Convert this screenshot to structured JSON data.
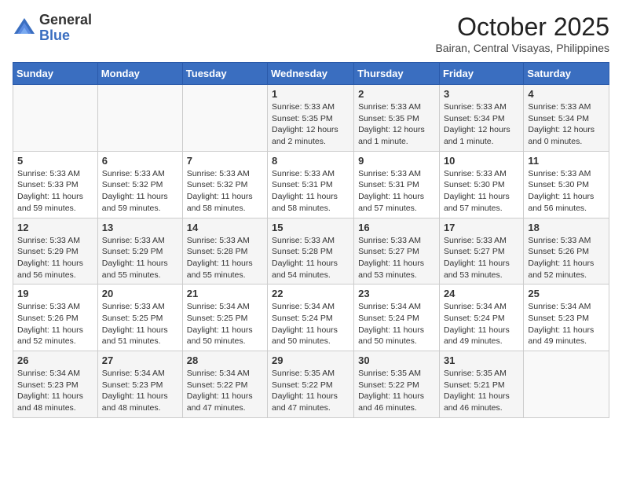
{
  "header": {
    "logo_general": "General",
    "logo_blue": "Blue",
    "month_title": "October 2025",
    "location": "Bairan, Central Visayas, Philippines"
  },
  "weekdays": [
    "Sunday",
    "Monday",
    "Tuesday",
    "Wednesday",
    "Thursday",
    "Friday",
    "Saturday"
  ],
  "weeks": [
    [
      {
        "day": "",
        "sunrise": "",
        "sunset": "",
        "daylight": ""
      },
      {
        "day": "",
        "sunrise": "",
        "sunset": "",
        "daylight": ""
      },
      {
        "day": "",
        "sunrise": "",
        "sunset": "",
        "daylight": ""
      },
      {
        "day": "1",
        "sunrise": "Sunrise: 5:33 AM",
        "sunset": "Sunset: 5:35 PM",
        "daylight": "Daylight: 12 hours and 2 minutes."
      },
      {
        "day": "2",
        "sunrise": "Sunrise: 5:33 AM",
        "sunset": "Sunset: 5:35 PM",
        "daylight": "Daylight: 12 hours and 1 minute."
      },
      {
        "day": "3",
        "sunrise": "Sunrise: 5:33 AM",
        "sunset": "Sunset: 5:34 PM",
        "daylight": "Daylight: 12 hours and 1 minute."
      },
      {
        "day": "4",
        "sunrise": "Sunrise: 5:33 AM",
        "sunset": "Sunset: 5:34 PM",
        "daylight": "Daylight: 12 hours and 0 minutes."
      }
    ],
    [
      {
        "day": "5",
        "sunrise": "Sunrise: 5:33 AM",
        "sunset": "Sunset: 5:33 PM",
        "daylight": "Daylight: 11 hours and 59 minutes."
      },
      {
        "day": "6",
        "sunrise": "Sunrise: 5:33 AM",
        "sunset": "Sunset: 5:32 PM",
        "daylight": "Daylight: 11 hours and 59 minutes."
      },
      {
        "day": "7",
        "sunrise": "Sunrise: 5:33 AM",
        "sunset": "Sunset: 5:32 PM",
        "daylight": "Daylight: 11 hours and 58 minutes."
      },
      {
        "day": "8",
        "sunrise": "Sunrise: 5:33 AM",
        "sunset": "Sunset: 5:31 PM",
        "daylight": "Daylight: 11 hours and 58 minutes."
      },
      {
        "day": "9",
        "sunrise": "Sunrise: 5:33 AM",
        "sunset": "Sunset: 5:31 PM",
        "daylight": "Daylight: 11 hours and 57 minutes."
      },
      {
        "day": "10",
        "sunrise": "Sunrise: 5:33 AM",
        "sunset": "Sunset: 5:30 PM",
        "daylight": "Daylight: 11 hours and 57 minutes."
      },
      {
        "day": "11",
        "sunrise": "Sunrise: 5:33 AM",
        "sunset": "Sunset: 5:30 PM",
        "daylight": "Daylight: 11 hours and 56 minutes."
      }
    ],
    [
      {
        "day": "12",
        "sunrise": "Sunrise: 5:33 AM",
        "sunset": "Sunset: 5:29 PM",
        "daylight": "Daylight: 11 hours and 56 minutes."
      },
      {
        "day": "13",
        "sunrise": "Sunrise: 5:33 AM",
        "sunset": "Sunset: 5:29 PM",
        "daylight": "Daylight: 11 hours and 55 minutes."
      },
      {
        "day": "14",
        "sunrise": "Sunrise: 5:33 AM",
        "sunset": "Sunset: 5:28 PM",
        "daylight": "Daylight: 11 hours and 55 minutes."
      },
      {
        "day": "15",
        "sunrise": "Sunrise: 5:33 AM",
        "sunset": "Sunset: 5:28 PM",
        "daylight": "Daylight: 11 hours and 54 minutes."
      },
      {
        "day": "16",
        "sunrise": "Sunrise: 5:33 AM",
        "sunset": "Sunset: 5:27 PM",
        "daylight": "Daylight: 11 hours and 53 minutes."
      },
      {
        "day": "17",
        "sunrise": "Sunrise: 5:33 AM",
        "sunset": "Sunset: 5:27 PM",
        "daylight": "Daylight: 11 hours and 53 minutes."
      },
      {
        "day": "18",
        "sunrise": "Sunrise: 5:33 AM",
        "sunset": "Sunset: 5:26 PM",
        "daylight": "Daylight: 11 hours and 52 minutes."
      }
    ],
    [
      {
        "day": "19",
        "sunrise": "Sunrise: 5:33 AM",
        "sunset": "Sunset: 5:26 PM",
        "daylight": "Daylight: 11 hours and 52 minutes."
      },
      {
        "day": "20",
        "sunrise": "Sunrise: 5:33 AM",
        "sunset": "Sunset: 5:25 PM",
        "daylight": "Daylight: 11 hours and 51 minutes."
      },
      {
        "day": "21",
        "sunrise": "Sunrise: 5:34 AM",
        "sunset": "Sunset: 5:25 PM",
        "daylight": "Daylight: 11 hours and 50 minutes."
      },
      {
        "day": "22",
        "sunrise": "Sunrise: 5:34 AM",
        "sunset": "Sunset: 5:24 PM",
        "daylight": "Daylight: 11 hours and 50 minutes."
      },
      {
        "day": "23",
        "sunrise": "Sunrise: 5:34 AM",
        "sunset": "Sunset: 5:24 PM",
        "daylight": "Daylight: 11 hours and 50 minutes."
      },
      {
        "day": "24",
        "sunrise": "Sunrise: 5:34 AM",
        "sunset": "Sunset: 5:24 PM",
        "daylight": "Daylight: 11 hours and 49 minutes."
      },
      {
        "day": "25",
        "sunrise": "Sunrise: 5:34 AM",
        "sunset": "Sunset: 5:23 PM",
        "daylight": "Daylight: 11 hours and 49 minutes."
      }
    ],
    [
      {
        "day": "26",
        "sunrise": "Sunrise: 5:34 AM",
        "sunset": "Sunset: 5:23 PM",
        "daylight": "Daylight: 11 hours and 48 minutes."
      },
      {
        "day": "27",
        "sunrise": "Sunrise: 5:34 AM",
        "sunset": "Sunset: 5:23 PM",
        "daylight": "Daylight: 11 hours and 48 minutes."
      },
      {
        "day": "28",
        "sunrise": "Sunrise: 5:34 AM",
        "sunset": "Sunset: 5:22 PM",
        "daylight": "Daylight: 11 hours and 47 minutes."
      },
      {
        "day": "29",
        "sunrise": "Sunrise: 5:35 AM",
        "sunset": "Sunset: 5:22 PM",
        "daylight": "Daylight: 11 hours and 47 minutes."
      },
      {
        "day": "30",
        "sunrise": "Sunrise: 5:35 AM",
        "sunset": "Sunset: 5:22 PM",
        "daylight": "Daylight: 11 hours and 46 minutes."
      },
      {
        "day": "31",
        "sunrise": "Sunrise: 5:35 AM",
        "sunset": "Sunset: 5:21 PM",
        "daylight": "Daylight: 11 hours and 46 minutes."
      },
      {
        "day": "",
        "sunrise": "",
        "sunset": "",
        "daylight": ""
      }
    ]
  ]
}
